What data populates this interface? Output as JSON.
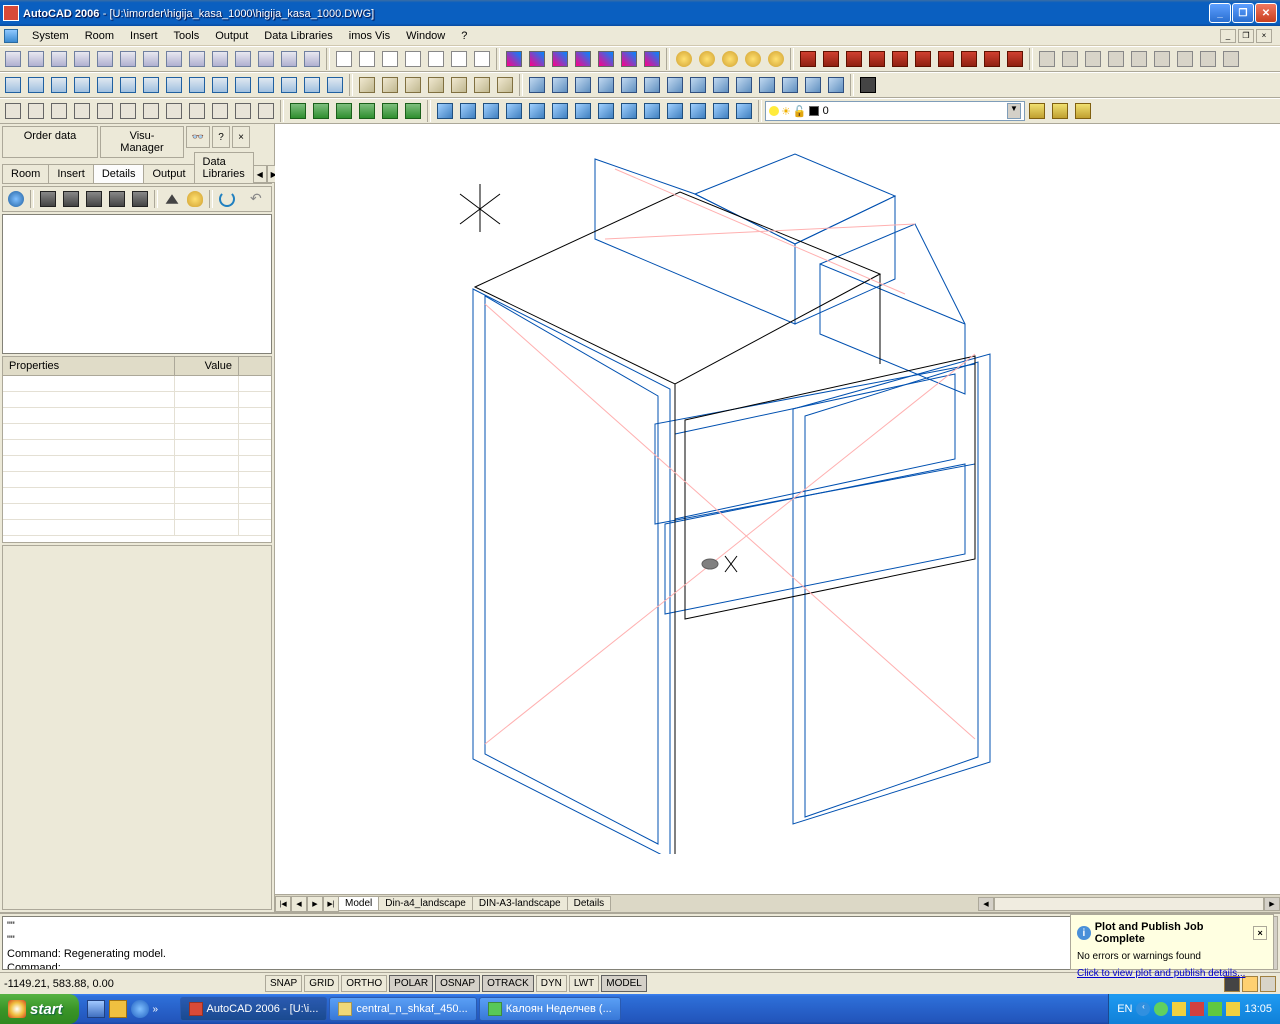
{
  "titlebar": {
    "app": "AutoCAD 2006",
    "doc": "- [U:\\imorder\\higija_kasa_1000\\higija_kasa_1000.DWG]"
  },
  "menu": [
    "System",
    "Room",
    "Insert",
    "Tools",
    "Output",
    "Data Libraries",
    "imos Vis",
    "Window",
    "?"
  ],
  "leftpanel": {
    "btn_orderdata": "Order data",
    "btn_visumanager": "Visu-Manager",
    "tabs": [
      "Room",
      "Insert",
      "Details",
      "Output",
      "Data Libraries"
    ],
    "active_tab": 2,
    "prop_col1": "Properties",
    "prop_col2": "Value"
  },
  "layer": {
    "value": "0"
  },
  "model_tabs": [
    "Model",
    "Din-a4_landscape",
    "DIN-A3-landscape",
    "Details"
  ],
  "cmd": {
    "line1": "\"\"",
    "line2": "\"\"",
    "line3": "Command: Regenerating model.",
    "line4": "Command:"
  },
  "notification": {
    "title": "Plot and Publish Job Complete",
    "body": "No errors or warnings found",
    "link": "Click to view plot and publish details..."
  },
  "status": {
    "coords": "-1149.21, 583.88, 0.00",
    "toggles": [
      "SNAP",
      "GRID",
      "ORTHO",
      "POLAR",
      "OSNAP",
      "OTRACK",
      "DYN",
      "LWT",
      "MODEL"
    ],
    "toggle_on": [
      3,
      4,
      5,
      8
    ]
  },
  "taskbar": {
    "start": "start",
    "tasks": [
      {
        "label": "AutoCAD 2006 - [U:\\i...",
        "active": true,
        "color": "#d84a38"
      },
      {
        "label": "central_n_shkaf_450...",
        "active": false,
        "color": "#f0d878"
      },
      {
        "label": "Калоян Неделчев (...",
        "active": false,
        "color": "#58c858"
      }
    ],
    "lang": "EN",
    "clock": "13:05"
  }
}
